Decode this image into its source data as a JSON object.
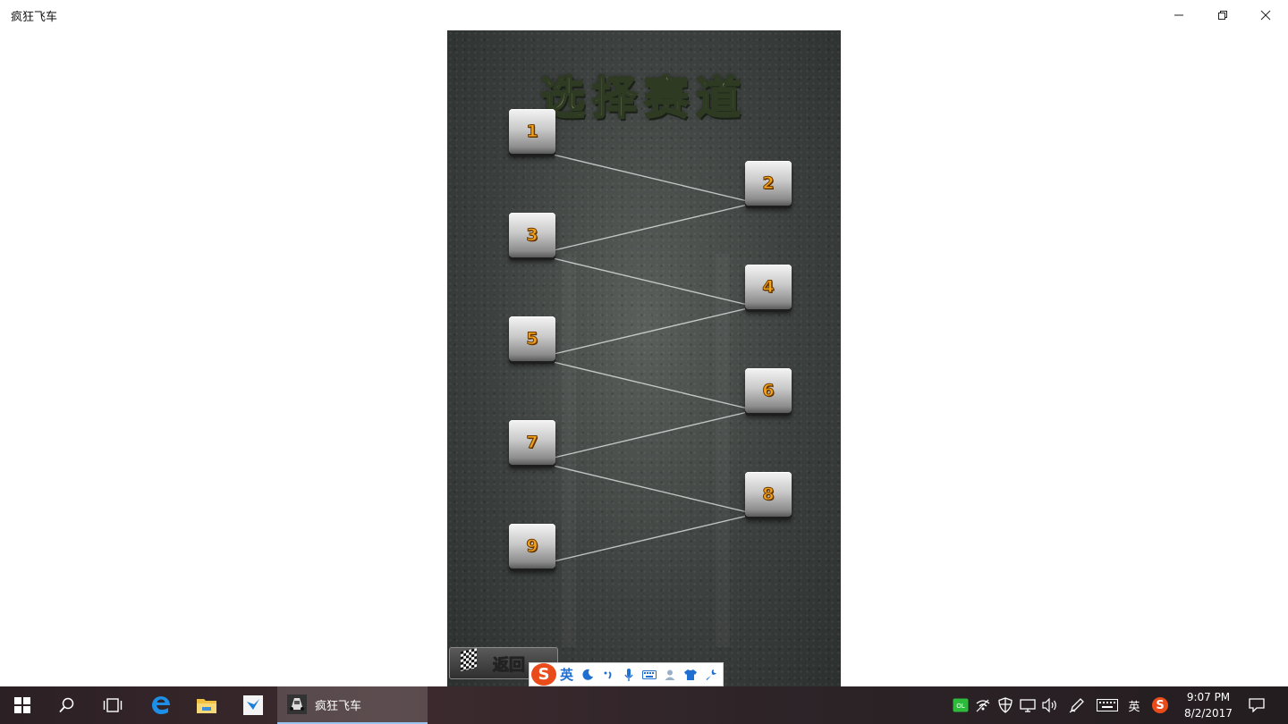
{
  "window": {
    "title": "疯狂飞车",
    "controls": {
      "minimize": "minimize-icon",
      "restore": "restore-icon",
      "close": "close-icon"
    }
  },
  "game": {
    "title": "选择赛道",
    "tracks": [
      "1",
      "2",
      "3",
      "4",
      "5",
      "6",
      "7",
      "8",
      "9"
    ],
    "back_label": "返回"
  },
  "ime_toolbar": {
    "logo": "S",
    "language": "英",
    "icons": [
      "moon-icon",
      "punctuation-icon",
      "microphone-icon",
      "keyboard-icon",
      "user-icon",
      "skin-shirt-icon",
      "wrench-icon"
    ]
  },
  "taskbar": {
    "start_icon": "windows-logo-icon",
    "pinned": [
      "search-icon",
      "task-view-icon",
      "edge-icon",
      "file-explorer-icon",
      "app-store-icon"
    ],
    "active_app": {
      "label": "疯狂飞车",
      "icon": "race-car-icon"
    },
    "tray": {
      "items": [
        "wechat-icon",
        "network-icon",
        "shield-icon",
        "display-icon",
        "volume-icon",
        "pen-icon",
        "keyboard-icon"
      ],
      "ime_label": "英",
      "ime_logo": "S"
    },
    "clock": {
      "time": "9:07 PM",
      "date": "8/2/2017"
    },
    "notification_icon": "action-center-icon"
  }
}
